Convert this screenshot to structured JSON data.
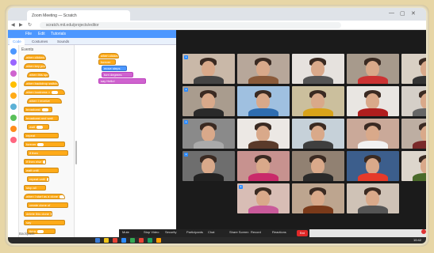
{
  "browser": {
    "tab_title": "Zoom Meeting — Scratch",
    "url": "scratch.mit.edu/projects/editor",
    "controls": [
      "—",
      "▢",
      "✕"
    ]
  },
  "scratch": {
    "menu": [
      "File",
      "Edit",
      "Tutorials"
    ],
    "tabs": [
      "Code",
      "Costumes",
      "Sounds"
    ],
    "palette_title": "Events",
    "categories": [
      {
        "color": "#4c97ff"
      },
      {
        "color": "#9966ff"
      },
      {
        "color": "#cf63cf"
      },
      {
        "color": "#ffbf00"
      },
      {
        "color": "#ffab19"
      },
      {
        "color": "#5cb1d6"
      },
      {
        "color": "#59c059"
      },
      {
        "color": "#ff8c1a"
      },
      {
        "color": "#ff6680"
      }
    ],
    "palette_blocks": [
      "when clicked",
      "when key pressed",
      "when this sprite clicked",
      "when backdrop switches",
      "when loudness >",
      "when I receive",
      "broadcast",
      "broadcast and wait",
      "wait",
      "repeat",
      "forever",
      "if then",
      "if then else",
      "wait until",
      "repeat until",
      "stop all",
      "when I start as a clone",
      "create clone of",
      "delete this clone",
      "say",
      "think"
    ],
    "script_blocks": [
      "when clicked",
      "forever",
      "move steps",
      "turn degrees",
      "say Hello!"
    ],
    "bottom_label": "Backpack"
  },
  "zoom": {
    "tiles": [
      {
        "bg": "#c9b8a8",
        "shirt": "#444"
      },
      {
        "bg": "#b7a79a",
        "shirt": "#8a5a3a"
      },
      {
        "bg": "#e6e2de",
        "shirt": "#555"
      },
      {
        "bg": "#a79a8c",
        "shirt": "#c33"
      },
      {
        "bg": "#d9d0c4",
        "shirt": "#333"
      },
      {
        "bg": "#a99c8e",
        "shirt": "#2a2a2a"
      },
      {
        "bg": "#9fc0e0",
        "shirt": "#2f6db0"
      },
      {
        "bg": "#cbbf9d",
        "shirt": "#d8a31a"
      },
      {
        "bg": "#e9e6e2",
        "shirt": "#b01e1e"
      },
      {
        "bg": "#d5cfc8",
        "shirt": "#666"
      },
      {
        "bg": "#8a8a8a",
        "shirt": "#aaa"
      },
      {
        "bg": "#ece8e4",
        "shirt": "#5a3a2a"
      },
      {
        "bg": "#c6d1d9",
        "shirt": "#3f3f3f"
      },
      {
        "bg": "#caa999",
        "shirt": "#f2f2f2"
      },
      {
        "bg": "#bdaea2",
        "shirt": "#7a2a2a"
      },
      {
        "bg": "#6e6e6e",
        "shirt": "#222"
      },
      {
        "bg": "#c7928f",
        "shirt": "#c92a6a"
      },
      {
        "bg": "#918172",
        "shirt": "#2a2a2a"
      },
      {
        "bg": "#3c5e8c",
        "shirt": "#e63a2a"
      },
      {
        "bg": "#ddd6cc",
        "shirt": "#4a6a2a"
      },
      {
        "bg": "#d8bdb5",
        "shirt": "#c95a9a"
      },
      {
        "bg": "#bda58f",
        "shirt": "#7a3a1a"
      },
      {
        "bg": "#cfc2b6",
        "shirt": "#555"
      }
    ],
    "controls": [
      "Mute",
      "Stop Video",
      "Security",
      "Participants",
      "Chat",
      "Share Screen",
      "Record",
      "Reactions"
    ],
    "end_label": "End"
  },
  "taskbar": {
    "icons": [
      {
        "color": "#3a7bd5"
      },
      {
        "color": "#f0c419"
      },
      {
        "color": "#e94335"
      },
      {
        "color": "#2d8cff"
      },
      {
        "color": "#34a853"
      },
      {
        "color": "#ea4335"
      },
      {
        "color": "#1aa260"
      },
      {
        "color": "#ff9f00"
      }
    ],
    "time": "10:42"
  }
}
